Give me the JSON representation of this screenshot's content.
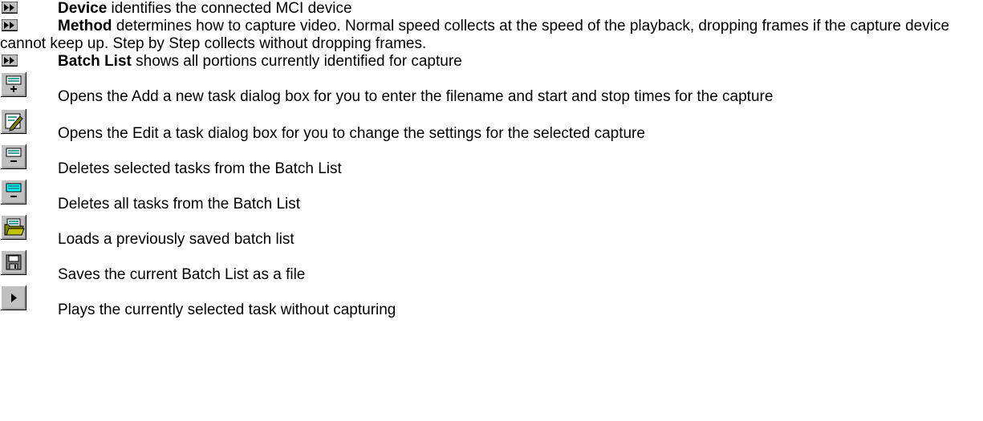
{
  "bullets": [
    {
      "icon": "fast-forward-bullet-icon",
      "term": "Device",
      "desc": " identifies the connected MCI device"
    },
    {
      "icon": "fast-forward-bullet-icon",
      "term": "Method",
      "desc": " determines how to capture video. Normal speed collects at the speed of the playback, dropping frames if the capture device cannot keep up. Step by Step collects without dropping frames."
    },
    {
      "icon": "fast-forward-bullet-icon",
      "term": "Batch List",
      "desc": " shows all portions currently identified for capture"
    }
  ],
  "tools": [
    {
      "icon": "add-task-icon",
      "desc": "Opens the Add a new task dialog box for you to enter the filename and start and stop times for the capture"
    },
    {
      "icon": "edit-task-icon",
      "desc": "Opens the Edit a task dialog box for you to change the settings for the selected capture"
    },
    {
      "icon": "delete-selected-tasks-icon",
      "desc": "Deletes selected tasks from the Batch List"
    },
    {
      "icon": "delete-all-tasks-icon",
      "desc": "Deletes all tasks from the Batch List"
    },
    {
      "icon": "open-batch-list-icon",
      "desc": "Loads a previously saved batch list"
    },
    {
      "icon": "save-batch-list-icon",
      "desc": "Saves the current Batch List as a file"
    },
    {
      "icon": "play-task-icon",
      "desc": "Plays the currently selected task without capturing"
    }
  ],
  "colors": {
    "text": "#000000",
    "background": "#ffffff",
    "button_face": "#c0c0c0",
    "button_shadow": "#808080",
    "icon_teal": "#008080",
    "icon_cyan": "#00ffff"
  }
}
